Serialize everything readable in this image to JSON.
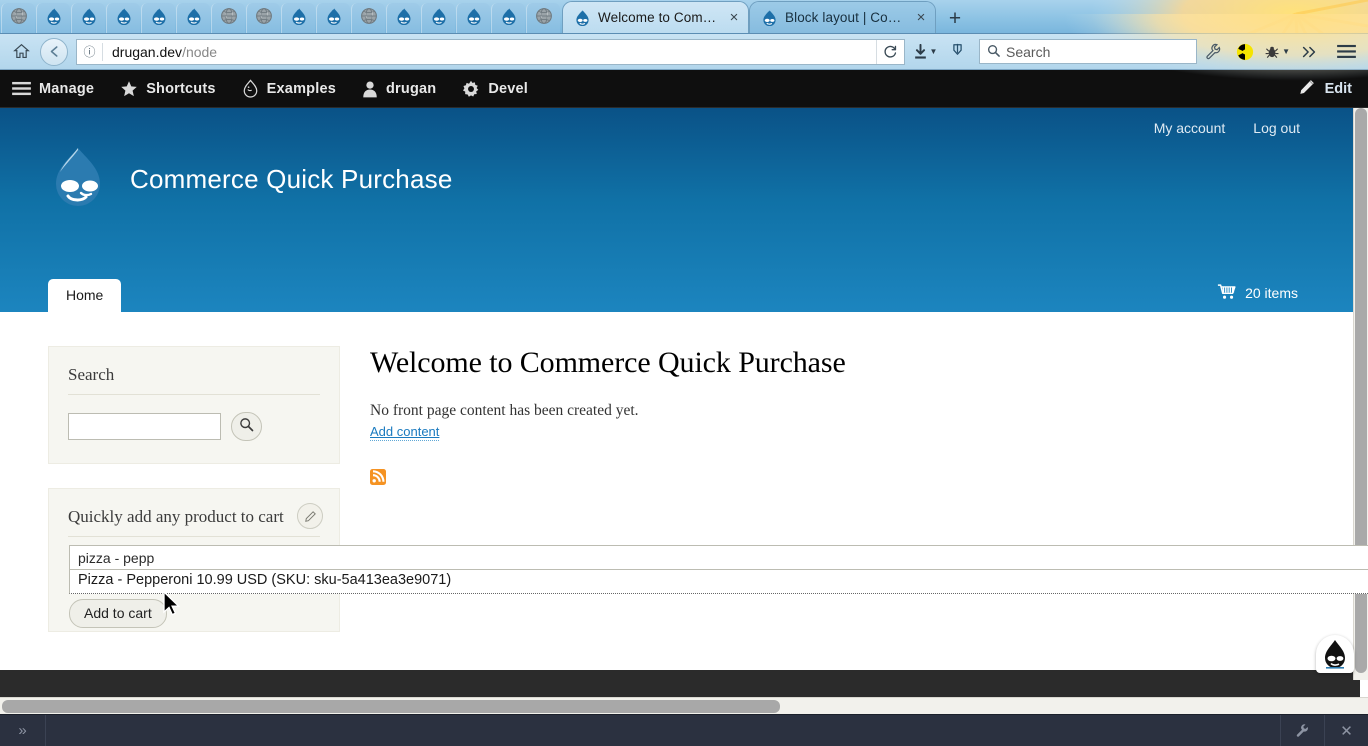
{
  "browser": {
    "pinned_tabs": [
      {
        "icon": "globe-icon"
      },
      {
        "icon": "drupal-drop-icon"
      },
      {
        "icon": "drupal-drop-icon"
      },
      {
        "icon": "drupal-drop-icon"
      },
      {
        "icon": "drupal-drop-icon"
      },
      {
        "icon": "drupal-drop-icon"
      },
      {
        "icon": "globe-icon"
      },
      {
        "icon": "globe-icon"
      },
      {
        "icon": "drupal-drop-icon"
      },
      {
        "icon": "drupal-drop-icon"
      },
      {
        "icon": "globe-icon"
      },
      {
        "icon": "drupal-drop-icon"
      },
      {
        "icon": "drupal-drop-icon"
      },
      {
        "icon": "drupal-drop-icon"
      },
      {
        "icon": "drupal-drop-icon"
      },
      {
        "icon": "globe-icon"
      }
    ],
    "tabs": [
      {
        "title": "Welcome to Com…",
        "active": true,
        "close": "×",
        "icon": "drupal-drop-icon"
      },
      {
        "title": "Block layout | Co…",
        "active": false,
        "close": "×",
        "icon": "drupal-drop-icon"
      }
    ],
    "new_tab_label": "+",
    "url": "drugan.dev",
    "url_path": "/node",
    "reload_label": "↻",
    "search_placeholder": "Search",
    "home_icon": "home-icon",
    "back_icon": "back-arrow-icon",
    "info_icon": "info-icon",
    "download_icon": "download-icon",
    "save_icon": "save-to-pocket-icon",
    "wrench_icon": "wrench-icon",
    "radiation_icon": "radiation-icon",
    "bug_icon": "bug-icon",
    "overflow_icon": "chevron-double-right-icon",
    "menu_icon": "hamburger-menu-icon"
  },
  "admin_toolbar": {
    "items": [
      {
        "label": "Manage",
        "icon": "hamburger-menu-icon"
      },
      {
        "label": "Shortcuts",
        "icon": "star-icon"
      },
      {
        "label": "Examples",
        "icon": "drupal-drop-icon"
      },
      {
        "label": "drugan",
        "icon": "user-icon"
      },
      {
        "label": "Devel",
        "icon": "gear-icon"
      }
    ],
    "edit": {
      "label": "Edit",
      "icon": "pencil-icon"
    }
  },
  "site": {
    "name": "Commerce Quick Purchase",
    "logo_icon": "drupal-drop-logo",
    "account_links": [
      {
        "label": "My account"
      },
      {
        "label": "Log out"
      }
    ],
    "cart": {
      "icon": "shopping-cart-icon",
      "label": "20 items"
    },
    "primary_tabs": [
      {
        "label": "Home",
        "active": true
      }
    ]
  },
  "sidebar": {
    "search_block": {
      "title": "Search",
      "input_value": "",
      "input_placeholder": "",
      "button_icon": "magnifier-icon"
    },
    "quick_purchase_block": {
      "title": "Quickly add any product to cart",
      "edit_icon": "pencil-icon",
      "autocomplete_value": "pizza - pepp",
      "autocomplete_placeholder": "",
      "suggestion": "Pizza - Pepperoni 10.99 USD (SKU: sku-5a413ea3e9071)",
      "submit_label": "Add to cart"
    }
  },
  "main": {
    "title": "Welcome to Commerce Quick Purchase",
    "message": "No front page content has been created yet.",
    "add_content_link": "Add content",
    "rss_icon": "rss-feed-icon"
  },
  "console": {
    "prompt": "»",
    "input_value": "",
    "wrench_icon": "wrench-icon",
    "close_icon": "close-icon"
  },
  "devel_badge": {
    "icon": "drupal-drop-icon"
  },
  "colors": {
    "header_top": "#0a5287",
    "header_bottom": "#1c85bf",
    "admin_bar": "#0f0f0f",
    "link": "#1a7abf",
    "block_bg": "#f6f6f1",
    "footer": "#2b2b2b",
    "console_bg": "#2b3140",
    "rss_orange": "#f59323"
  }
}
